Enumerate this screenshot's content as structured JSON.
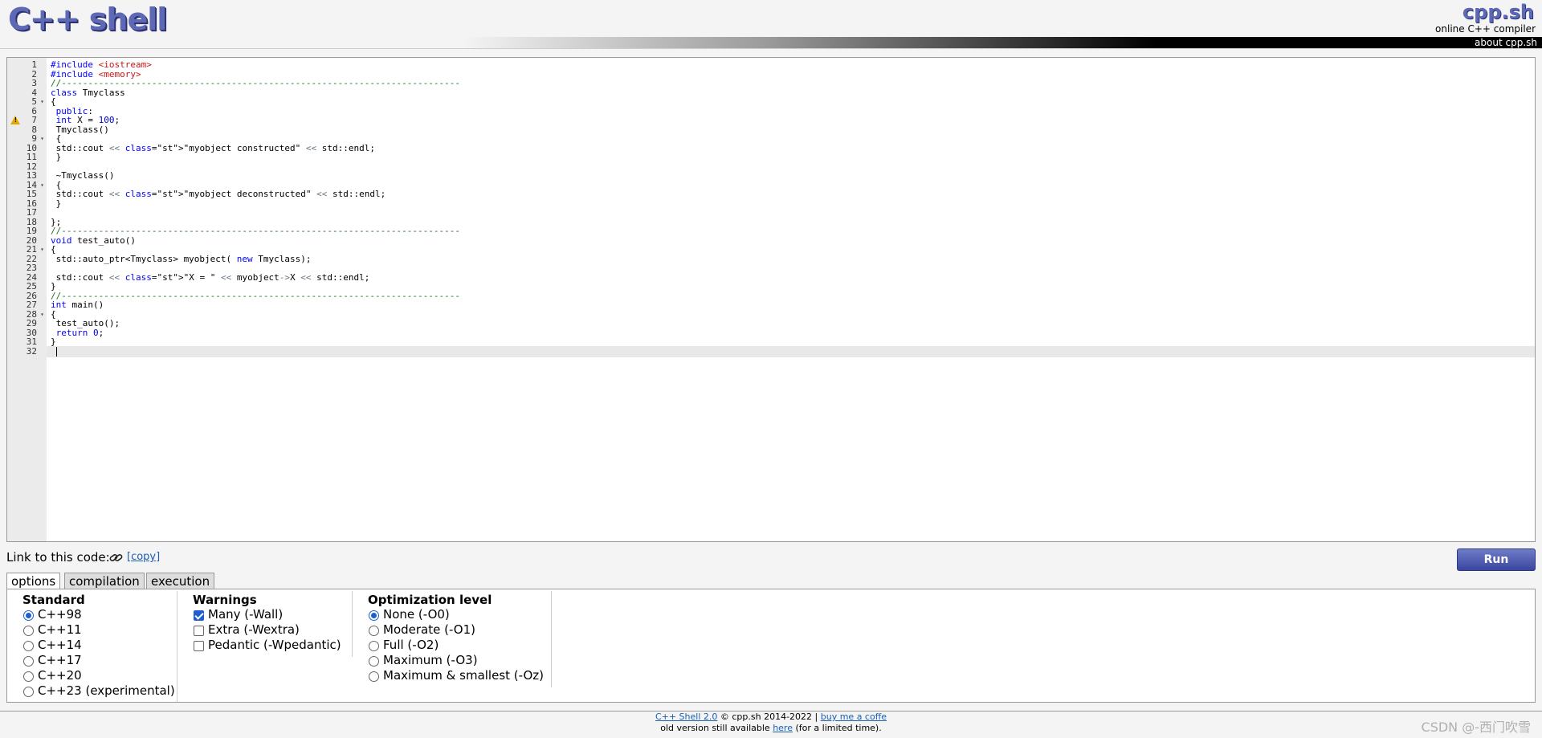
{
  "header": {
    "logo": "C++ shell",
    "site_name": "cpp.sh",
    "site_subtitle": "online C++ compiler",
    "about_link": "about cpp.sh"
  },
  "editor": {
    "warning_line": 7,
    "active_line": 32,
    "fold_lines": [
      5,
      9,
      14,
      21,
      28
    ],
    "lines": [
      "#include <iostream>",
      "#include <memory>",
      "//---------------------------------------------------------------------------",
      "class Tmyclass",
      "{",
      " public:",
      " int X = 100;",
      " Tmyclass()",
      " {",
      " std::cout << \"myobject constructed\" << std::endl;",
      " }",
      "",
      " ~Tmyclass()",
      " {",
      " std::cout << \"myobject deconstructed\" << std::endl;",
      " }",
      "",
      "};",
      "//---------------------------------------------------------------------------",
      "void test_auto()",
      "{",
      " std::auto_ptr<Tmyclass> myobject( new Tmyclass);",
      "",
      " std::cout << \"X = \" << myobject->X << std::endl;",
      "}",
      "//---------------------------------------------------------------------------",
      "int main()",
      "{",
      " test_auto();",
      " return 0;",
      "}",
      ""
    ]
  },
  "link": {
    "label": "Link to this code:",
    "icon": "link-icon",
    "copy_label": "[copy]"
  },
  "run_button": "Run",
  "tabs": [
    {
      "label": "options",
      "active": true
    },
    {
      "label": "compilation",
      "active": false
    },
    {
      "label": "execution",
      "active": false
    }
  ],
  "options": {
    "standard": {
      "title": "Standard",
      "items": [
        {
          "label": "C++98",
          "checked": true
        },
        {
          "label": "C++11",
          "checked": false
        },
        {
          "label": "C++14",
          "checked": false
        },
        {
          "label": "C++17",
          "checked": false
        },
        {
          "label": "C++20",
          "checked": false
        },
        {
          "label": "C++23 (experimental)",
          "checked": false
        }
      ]
    },
    "warnings": {
      "title": "Warnings",
      "items": [
        {
          "label": "Many (-Wall)",
          "checked": true
        },
        {
          "label": "Extra (-Wextra)",
          "checked": false
        },
        {
          "label": "Pedantic (-Wpedantic)",
          "checked": false
        }
      ]
    },
    "optimization": {
      "title": "Optimization level",
      "items": [
        {
          "label": "None (-O0)",
          "checked": true
        },
        {
          "label": "Moderate (-O1)",
          "checked": false
        },
        {
          "label": "Full (-O2)",
          "checked": false
        },
        {
          "label": "Maximum (-O3)",
          "checked": false
        },
        {
          "label": "Maximum & smallest (-Oz)",
          "checked": false
        }
      ]
    }
  },
  "footer": {
    "version_link": "C++ Shell 2.0",
    "copyright": "© cpp.sh 2014-2022 |",
    "coffee_link": "buy me a coffe",
    "old_prefix": "old version still available",
    "here_link": "here",
    "old_suffix": "(for a limited time)."
  },
  "watermark": "CSDN @-西门吹雪"
}
